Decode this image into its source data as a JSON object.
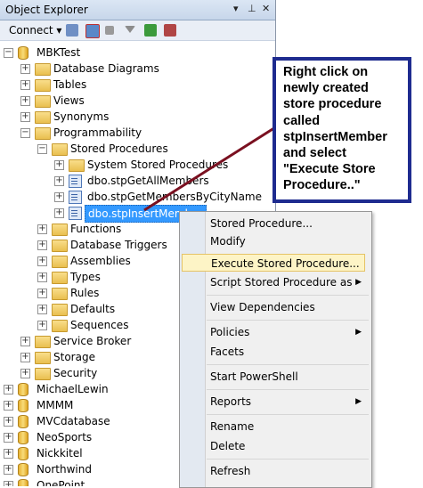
{
  "panel": {
    "title": "Object Explorer",
    "title_controls": [
      "▾",
      "⊥",
      "✕"
    ],
    "toolbar": {
      "connect_label": "Connect ▾"
    }
  },
  "tree": [
    {
      "label": "MBKTest",
      "icon": "database-icon",
      "expander": "−"
    },
    {
      "label": "Database Diagrams",
      "icon": "folder-icon",
      "expander": "+"
    },
    {
      "label": "Tables",
      "icon": "folder-icon",
      "expander": "+"
    },
    {
      "label": "Views",
      "icon": "folder-icon",
      "expander": "+"
    },
    {
      "label": "Synonyms",
      "icon": "folder-icon",
      "expander": "+"
    },
    {
      "label": "Programmability",
      "icon": "folder-icon",
      "expander": "−"
    },
    {
      "label": "Stored Procedures",
      "icon": "folder-icon",
      "expander": "−"
    },
    {
      "label": "System Stored Procedures",
      "icon": "folder-icon",
      "expander": "+"
    },
    {
      "label": "dbo.stpGetAllMembers",
      "icon": "stored-procedure-icon",
      "expander": "+"
    },
    {
      "label": "dbo.stpGetMembersByCityName",
      "icon": "stored-procedure-icon",
      "expander": "+"
    },
    {
      "label": "dbo.stpInsertMember",
      "icon": "stored-procedure-icon",
      "expander": "+",
      "selected": true
    },
    {
      "label": "Functions",
      "icon": "folder-icon",
      "expander": "+"
    },
    {
      "label": "Database Triggers",
      "icon": "folder-icon",
      "expander": "+"
    },
    {
      "label": "Assemblies",
      "icon": "folder-icon",
      "expander": "+"
    },
    {
      "label": "Types",
      "icon": "folder-icon",
      "expander": "+"
    },
    {
      "label": "Rules",
      "icon": "folder-icon",
      "expander": "+"
    },
    {
      "label": "Defaults",
      "icon": "folder-icon",
      "expander": "+"
    },
    {
      "label": "Sequences",
      "icon": "folder-icon",
      "expander": "+"
    },
    {
      "label": "Service Broker",
      "icon": "folder-icon",
      "expander": "+"
    },
    {
      "label": "Storage",
      "icon": "folder-icon",
      "expander": "+"
    },
    {
      "label": "Security",
      "icon": "folder-icon",
      "expander": "+"
    },
    {
      "label": "MichaelLewin",
      "icon": "database-icon",
      "expander": "+"
    },
    {
      "label": "MMMM",
      "icon": "database-icon",
      "expander": "+"
    },
    {
      "label": "MVCdatabase",
      "icon": "database-icon",
      "expander": "+"
    },
    {
      "label": "NeoSports",
      "icon": "database-icon",
      "expander": "+"
    },
    {
      "label": "Nickkitel",
      "icon": "database-icon",
      "expander": "+"
    },
    {
      "label": "Northwind",
      "icon": "database-icon",
      "expander": "+"
    },
    {
      "label": "OnePoint",
      "icon": "database-icon",
      "expander": "+"
    }
  ],
  "context_menu": {
    "items": [
      {
        "label": "Stored Procedure..."
      },
      {
        "label": "Modify"
      },
      {
        "label": "Execute Stored Procedure...",
        "highlighted": true
      },
      {
        "label": "Script Stored Procedure as",
        "submenu": "▶"
      },
      {
        "label": "View Dependencies"
      },
      {
        "label": "Policies",
        "submenu": "▶"
      },
      {
        "label": "Facets"
      },
      {
        "label": "Start PowerShell"
      },
      {
        "label": "Reports",
        "submenu": "▶"
      },
      {
        "label": "Rename"
      },
      {
        "label": "Delete"
      },
      {
        "label": "Refresh"
      }
    ]
  },
  "callout": {
    "lines": [
      "Right click on",
      "newly created",
      "store procedure",
      "called",
      "stpInsertMember",
      "and select",
      "\"Execute Store",
      "Procedure..\""
    ]
  },
  "colors": {
    "selection": "#3399ff",
    "callout_border": "#1e2b8f",
    "arrow": "#7a1020",
    "menu_highlight": "#fdf4c6"
  }
}
